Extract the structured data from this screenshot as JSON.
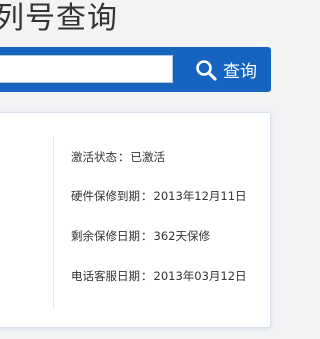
{
  "header": {
    "title": "列号查询"
  },
  "search": {
    "placeholder": "",
    "value": "",
    "button_label": "查询",
    "button_icon": "search-icon",
    "accent_color": "#1565c0"
  },
  "result": {
    "left_fragment": ")",
    "rows": [
      {
        "label": "激活状态",
        "value": "已激活"
      },
      {
        "label": "硬件保修到期",
        "value": "2013年12月11日"
      },
      {
        "label": "剩余保修日期",
        "value": "362天保修"
      },
      {
        "label": "电话客服日期",
        "value": "2013年03月12日"
      }
    ]
  }
}
